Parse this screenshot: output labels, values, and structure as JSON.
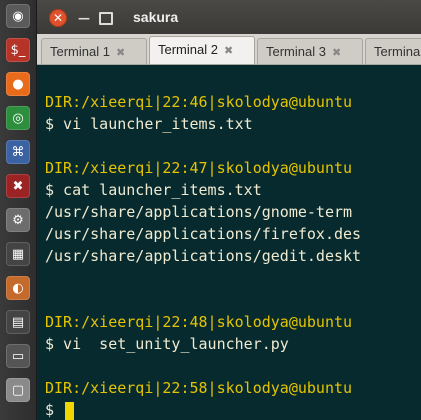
{
  "launcher": {
    "items": [
      {
        "icon": "ubuntu-logo-icon",
        "glyph": "◉",
        "color": "#5a5a5a"
      },
      {
        "icon": "terminal-app-icon",
        "glyph": "$_",
        "color": "#b53427"
      },
      {
        "icon": "firefox-icon",
        "glyph": "●",
        "color": "#e86b1c"
      },
      {
        "icon": "chrome-icon",
        "glyph": "◎",
        "color": "#2d8f3e"
      },
      {
        "icon": "network-icon",
        "glyph": "⌘",
        "color": "#3b62a3"
      },
      {
        "icon": "close-app-icon",
        "glyph": "✖",
        "color": "#9b2323"
      },
      {
        "icon": "settings-icon",
        "glyph": "⚙",
        "color": "#6d6d6d"
      },
      {
        "icon": "calculator-icon",
        "glyph": "▦",
        "color": "#444444"
      },
      {
        "icon": "software-center-icon",
        "glyph": "◐",
        "color": "#c46a2c"
      },
      {
        "icon": "system-monitor-icon",
        "glyph": "▤",
        "color": "#444444"
      },
      {
        "icon": "workspace-icon",
        "glyph": "▭",
        "color": "#555555"
      },
      {
        "icon": "trash-icon",
        "glyph": "▢",
        "color": "#8a8a8a"
      }
    ]
  },
  "window": {
    "title": "sakura",
    "controls": [
      "close-icon",
      "minimize-icon",
      "maximize-icon"
    ],
    "close_glyph": "✕",
    "min_glyph": "—"
  },
  "tabs": [
    {
      "label": "Terminal 1",
      "active": false
    },
    {
      "label": "Terminal 2",
      "active": true
    },
    {
      "label": "Terminal 3",
      "active": false
    },
    {
      "label": "Terminal",
      "active": false
    }
  ],
  "tab_close_glyph": "✖",
  "terminal": {
    "lines": [
      {
        "type": "prompt-dir",
        "text": "DIR:/xieerqi|22:46|skolodya@ubuntu"
      },
      {
        "type": "cmd",
        "text": "$ vi launcher_items.txt"
      },
      {
        "type": "blank",
        "text": ""
      },
      {
        "type": "prompt-dir",
        "text": "DIR:/xieerqi|22:47|skolodya@ubuntu"
      },
      {
        "type": "cmd",
        "text": "$ cat launcher_items.txt"
      },
      {
        "type": "out",
        "text": "/usr/share/applications/gnome-term"
      },
      {
        "type": "out",
        "text": "/usr/share/applications/firefox.des"
      },
      {
        "type": "out",
        "text": "/usr/share/applications/gedit.deskt"
      },
      {
        "type": "blank",
        "text": ""
      },
      {
        "type": "blank",
        "text": ""
      },
      {
        "type": "prompt-dir",
        "text": "DIR:/xieerqi|22:48|skolodya@ubuntu"
      },
      {
        "type": "cmd",
        "text": "$ vi  set_unity_launcher.py"
      },
      {
        "type": "blank",
        "text": ""
      },
      {
        "type": "prompt-dir",
        "text": "DIR:/xieerqi|22:58|skolodya@ubuntu"
      },
      {
        "type": "cmd-cursor",
        "text": "$ "
      }
    ]
  },
  "colors": {
    "terminal_bg": "#072a2e",
    "prompt_fg": "#e5c400",
    "text_fg": "#f0ead0",
    "cursor": "#f2d600"
  }
}
